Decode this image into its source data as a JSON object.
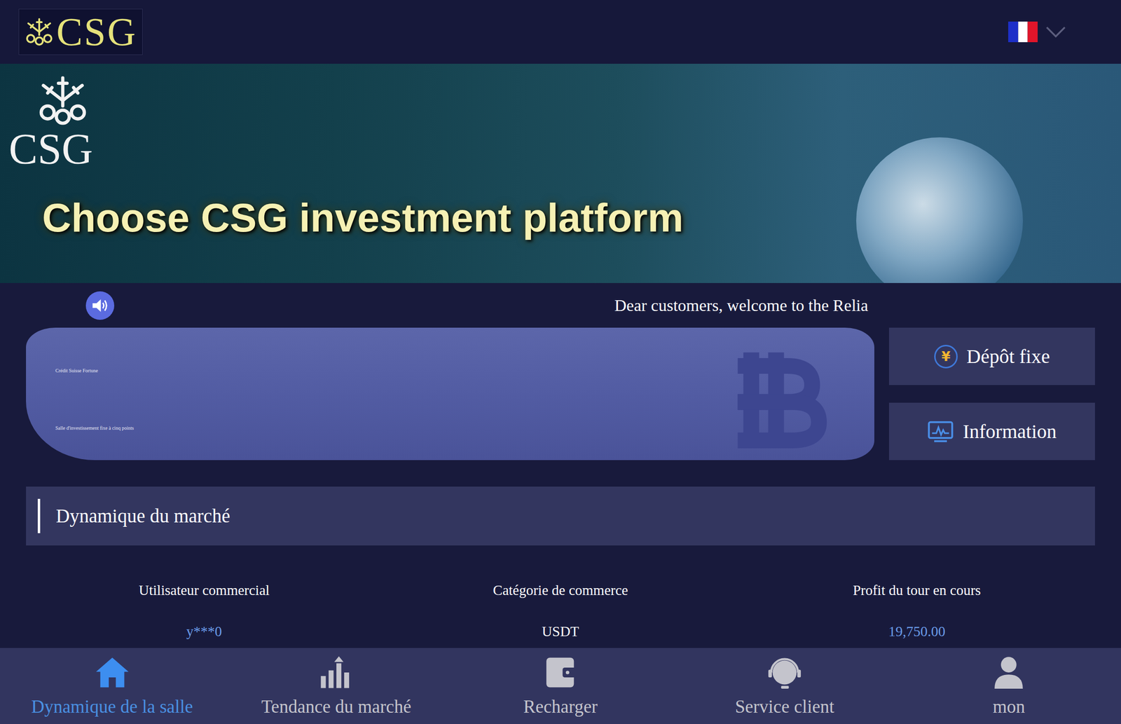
{
  "header": {
    "logo": "CSG"
  },
  "banner": {
    "logo": "CSG",
    "headline": "Choose CSG investment platform"
  },
  "ticker": {
    "text": "Dear customers, welcome to the Relia"
  },
  "promo_card": {
    "title": "Crédit Suisse Fortune",
    "subtitle": "Salle d'investissement fixe à cinq points"
  },
  "actions": [
    {
      "label": "Dépôt fixe",
      "kind": "yen",
      "icon": "¥"
    },
    {
      "label": "Information",
      "kind": "chart",
      "icon": ""
    }
  ],
  "market": {
    "title": "Dynamique du marché",
    "columns": [
      "Utilisateur commercial",
      "Catégorie de commerce",
      "Profit du tour en cours"
    ],
    "rows": [
      [
        "y***0",
        "USDT",
        "19,750.00"
      ]
    ]
  },
  "nav": [
    {
      "label": "Dynamique de la salle",
      "kind": "home",
      "selected": true
    },
    {
      "label": "Tendance du marché",
      "kind": "chart",
      "selected": false
    },
    {
      "label": "Recharger",
      "kind": "wallet",
      "selected": false
    },
    {
      "label": "Service client",
      "kind": "headset",
      "selected": false
    },
    {
      "label": "mon",
      "kind": "user",
      "selected": false
    }
  ]
}
